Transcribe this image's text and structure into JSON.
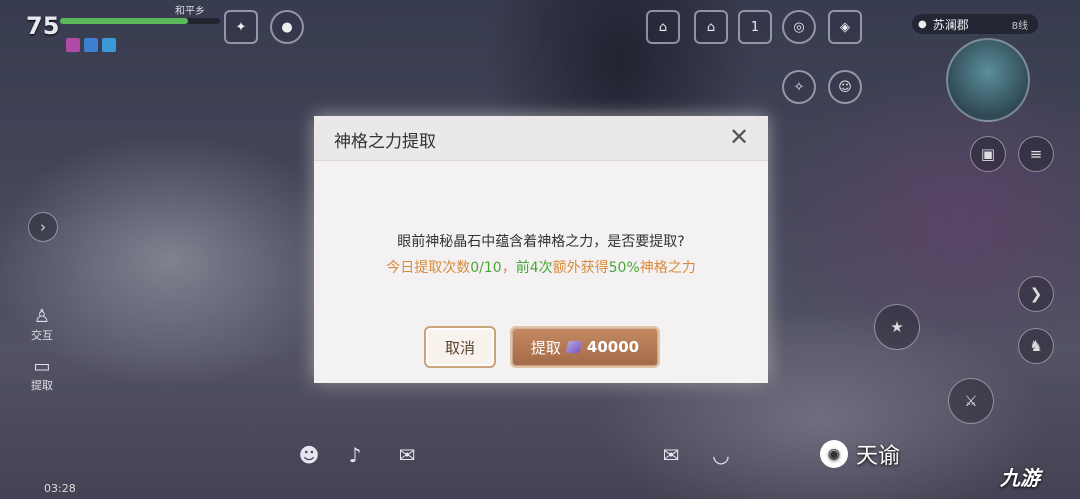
{
  "hud": {
    "level": "75",
    "player_name": "和平乡",
    "hp_fraction": 0.8,
    "region_name": "苏澜郡",
    "line": "8线",
    "clock": "03:28",
    "top_calendar_day": "1"
  },
  "left_buttons": {
    "interact_label": "交互",
    "extract_label": "提取"
  },
  "dialog": {
    "title": "神格之力提取",
    "message": "眼前神秘晶石中蕴含着神格之力，是否要提取?",
    "info": {
      "part1": "今日提取次数",
      "count": "0/10",
      "part2": "，",
      "first_n": "前4次",
      "part3": "额外获得",
      "bonus": "50%",
      "part4": "神格之力"
    },
    "cancel_label": "取消",
    "extract_label": "提取",
    "cost": "40000"
  },
  "watermark": {
    "text": "天谕",
    "logo": "九游"
  },
  "colors": {
    "orange": "#d98a3c",
    "green": "#4aa53a",
    "extract_button": "#b07550"
  }
}
